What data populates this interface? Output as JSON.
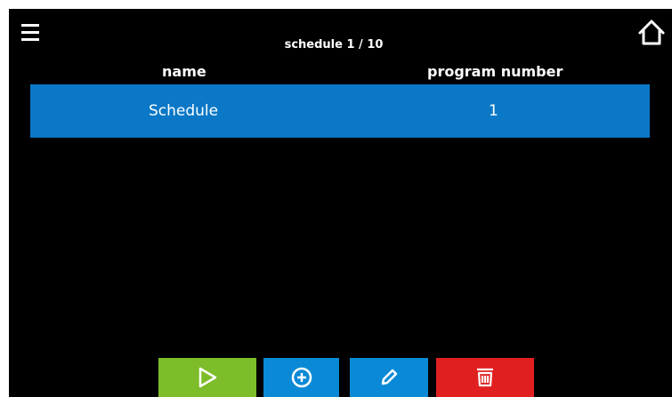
{
  "header": {
    "title": "schedule 1 / 10",
    "menu_icon": "hamburger-menu-icon",
    "home_icon": "home-icon"
  },
  "table": {
    "columns": [
      "name",
      "program number"
    ],
    "rows": [
      {
        "name": "Schedule",
        "program_number": "1"
      }
    ]
  },
  "toolbar": {
    "buttons": [
      {
        "icon": "play-icon",
        "color": "#7dbd2a"
      },
      {
        "icon": "add-circle-icon",
        "color": "#0a8ad6"
      },
      {
        "icon": "edit-pencil-icon",
        "color": "#0a8ad6"
      },
      {
        "icon": "delete-trash-icon",
        "color": "#e02020"
      }
    ]
  },
  "colors": {
    "background": "#000000",
    "selected_row": "#0a78c7",
    "text": "#ffffff"
  }
}
